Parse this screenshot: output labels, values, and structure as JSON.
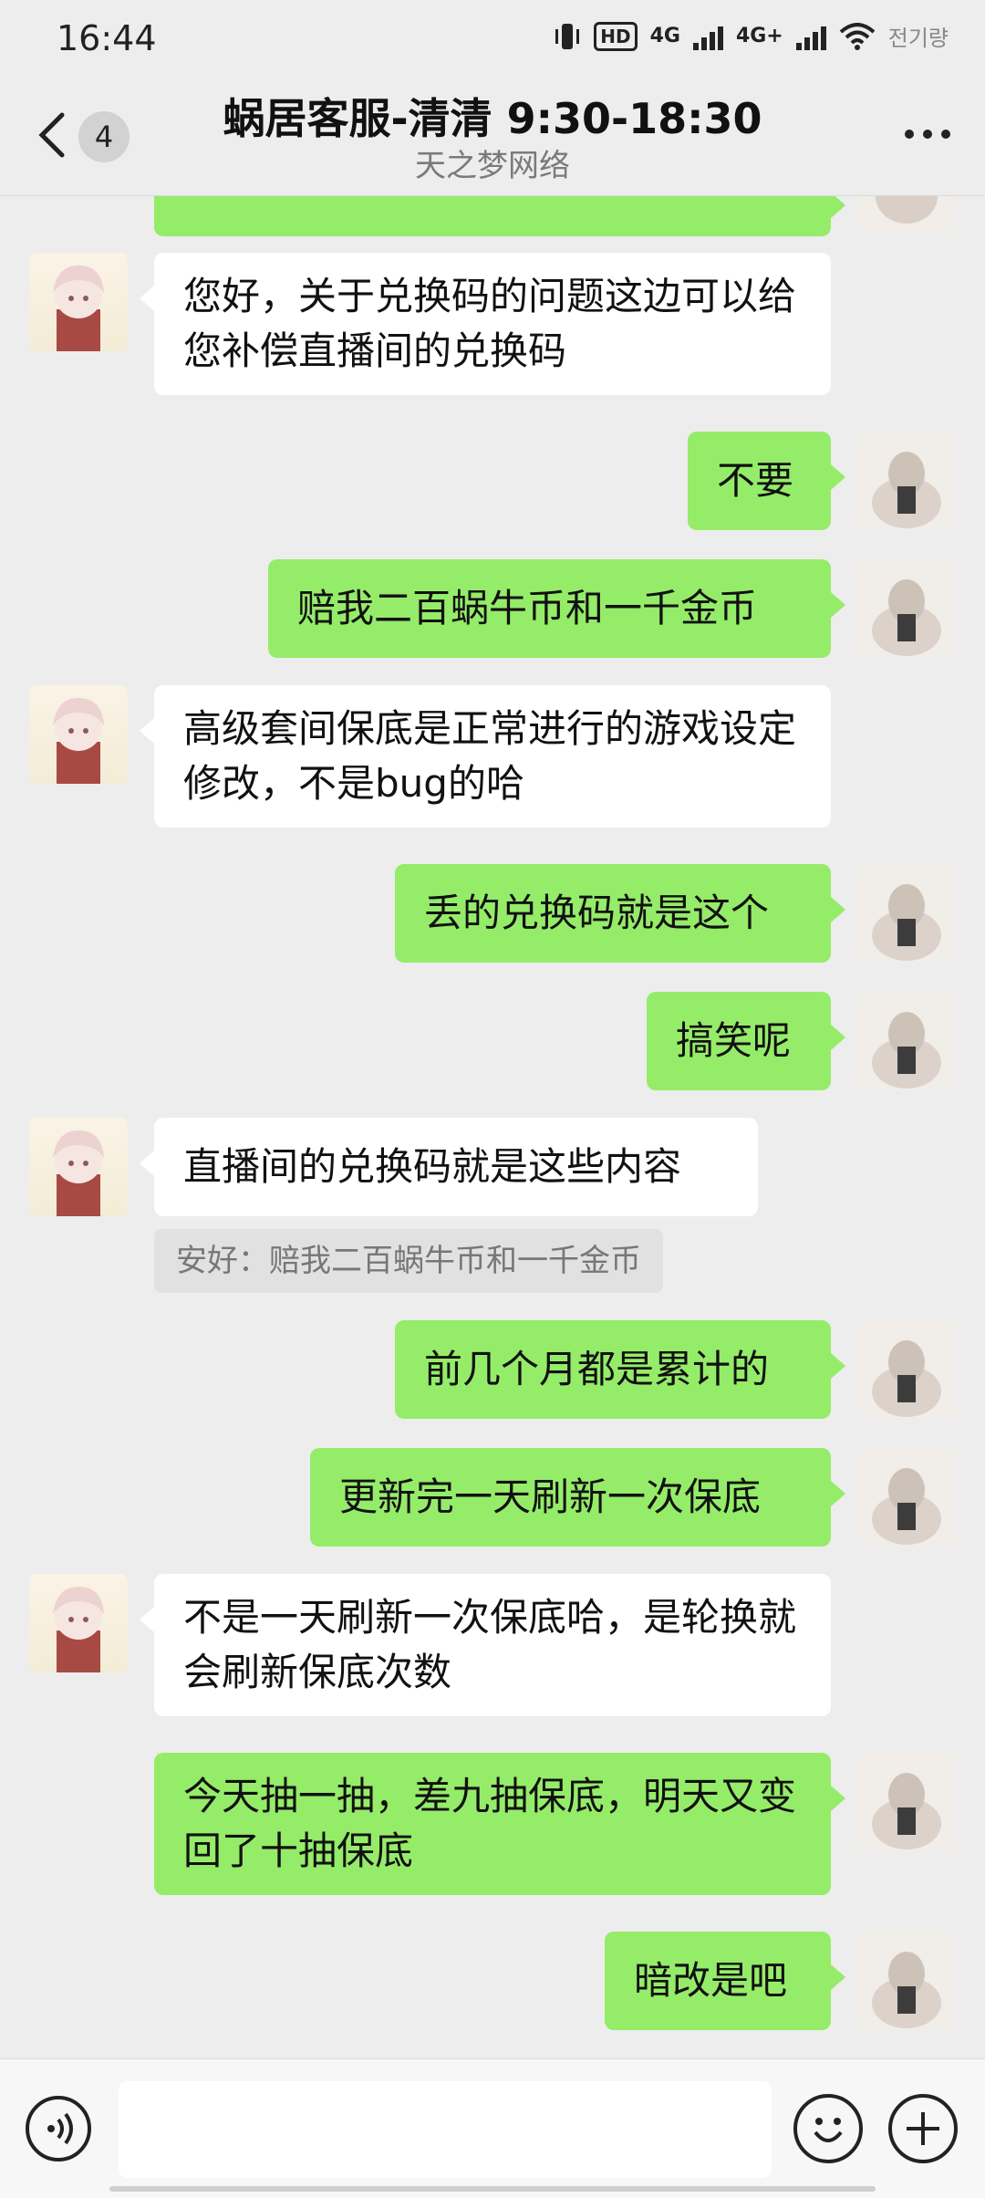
{
  "status_bar": {
    "time": "16:44",
    "hd_label": "HD",
    "net1": "4G",
    "net2": "4G+",
    "carrier": "전기량"
  },
  "header": {
    "unread_count": "4",
    "title": "蜗居客服-清清 9:30-18:30",
    "subtitle": "天之梦网络"
  },
  "messages": [
    {
      "from": "agent",
      "text": "您好，关于兑换码的问题这边可以给您补偿直播间的兑换码"
    },
    {
      "from": "user",
      "text": "不要"
    },
    {
      "from": "user",
      "text": "赔我二百蜗牛币和一千金币"
    },
    {
      "from": "agent",
      "text": "高级套间保底是正常进行的游戏设定修改，不是bug的哈"
    },
    {
      "from": "user",
      "text": "丢的兑换码就是这个"
    },
    {
      "from": "user",
      "text": "搞笑呢"
    },
    {
      "from": "agent",
      "text": "直播间的兑换码就是这些内容",
      "quote": "安好：赔我二百蜗牛币和一千金币"
    },
    {
      "from": "user",
      "text": "前几个月都是累计的"
    },
    {
      "from": "user",
      "text": "更新完一天刷新一次保底"
    },
    {
      "from": "agent",
      "text": "不是一天刷新一次保底哈，是轮换就会刷新保底次数"
    },
    {
      "from": "user",
      "text": "今天抽一抽，差九抽保底，明天又变回了十抽保底"
    },
    {
      "from": "user",
      "text": "暗改是吧"
    }
  ],
  "input": {
    "placeholder": ""
  },
  "colors": {
    "background": "#ededed",
    "outgoing_bubble": "#95ec69",
    "incoming_bubble": "#ffffff"
  }
}
